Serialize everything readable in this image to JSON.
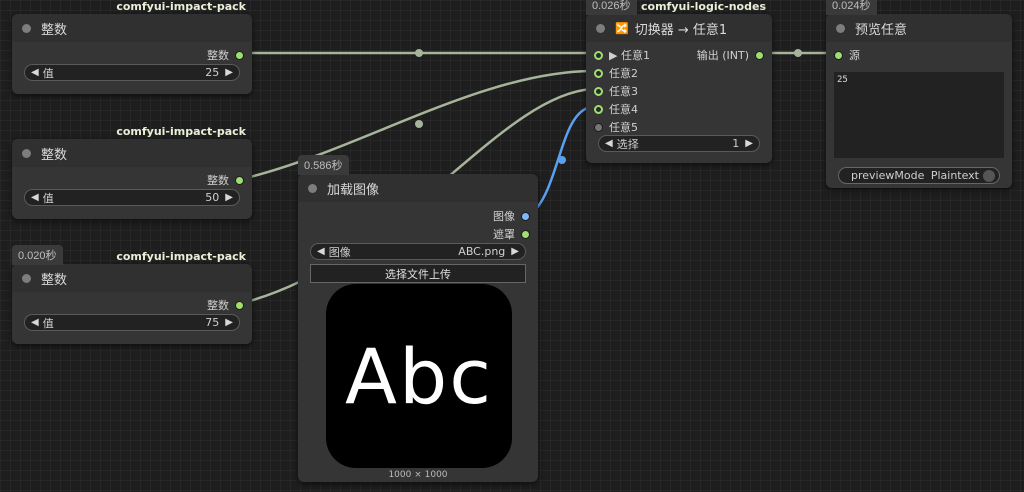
{
  "nodes": {
    "int1": {
      "source": "comfyui-impact-pack",
      "title": "整数",
      "output": "整数",
      "widget_label": "值",
      "widget_value": "25"
    },
    "int2": {
      "source": "comfyui-impact-pack",
      "title": "整数",
      "output": "整数",
      "widget_label": "值",
      "widget_value": "50"
    },
    "int3": {
      "time": "0.020秒",
      "source": "comfyui-impact-pack",
      "title": "整数",
      "output": "整数",
      "widget_label": "值",
      "widget_value": "75"
    },
    "load_image": {
      "time": "0.586秒",
      "title": "加载图像",
      "output_image": "图像",
      "output_mask": "遮罩",
      "widget_label": "图像",
      "widget_value": "ABC.png",
      "upload_button": "选择文件上传",
      "preview_text": "Abc",
      "image_size": "1000 × 1000"
    },
    "switch": {
      "time": "0.026秒",
      "source": "comfyui-logic-nodes",
      "title": "切换器 → 任意1",
      "inputs": [
        "▶ 任意1",
        "任意2",
        "任意3",
        "任意4",
        "任意5"
      ],
      "output": "输出 (INT)",
      "widget_label": "选择",
      "widget_value": "1"
    },
    "preview": {
      "time": "0.024秒",
      "title": "预览任意",
      "input": "源",
      "content": "25",
      "toggle_label": "previewMode",
      "toggle_value": "Plaintext"
    }
  },
  "colors": {
    "int_wire": "#a6b59a",
    "image_wire": "#5aa0f0",
    "background": "#1e1e1e",
    "node": "#353535"
  }
}
